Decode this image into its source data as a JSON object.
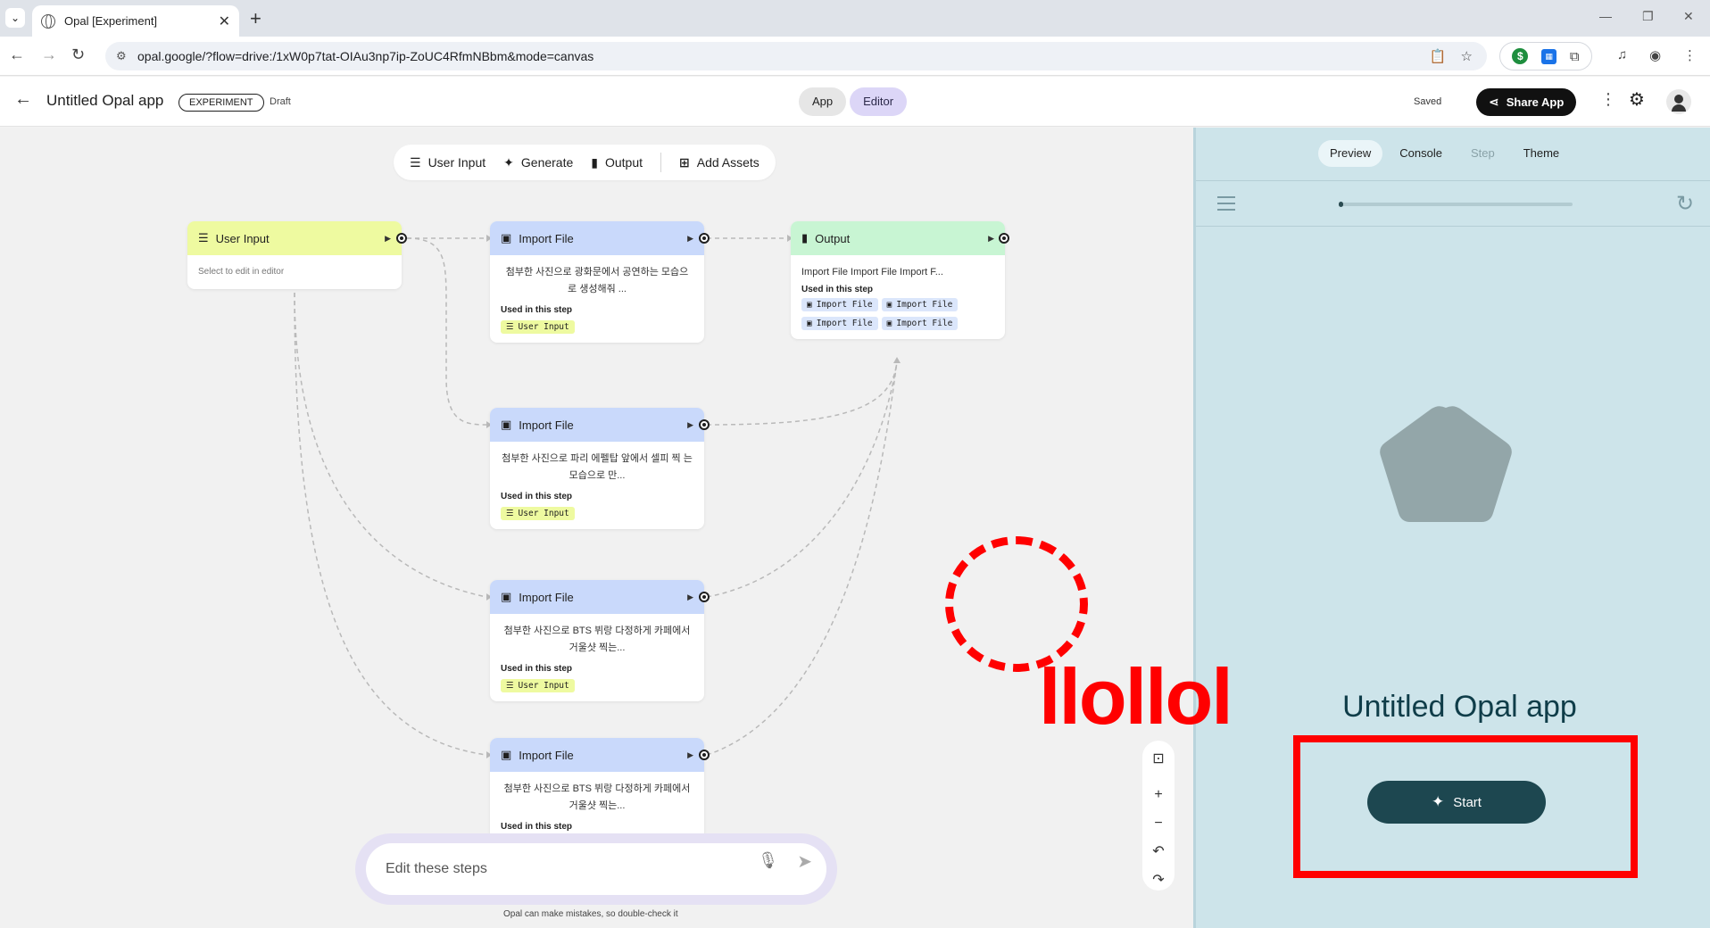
{
  "browser": {
    "tab_title": "Opal [Experiment]",
    "url": "opal.google/?flow=drive:/1xW0p7tat-OIAu3np7ip-ZoUC4RfmNBbm&mode=canvas"
  },
  "header": {
    "title": "Untitled Opal app",
    "badge": "EXPERIMENT",
    "status": "Draft",
    "modes": [
      "App",
      "Editor"
    ],
    "active_mode": "Editor",
    "saved": "Saved",
    "share": "Share App"
  },
  "stepbar": {
    "user_input": "User Input",
    "generate": "Generate",
    "output": "Output",
    "add_assets": "Add Assets"
  },
  "nodes": {
    "user_input": {
      "title": "User Input",
      "hint": "Select to edit in editor"
    },
    "import1": {
      "title": "Import File",
      "prompt": "첨부한 사진으로 광화문에서 공연하는 모습으 로 생성해줘 ...",
      "used_label": "Used in this step",
      "chip": "User Input"
    },
    "import2": {
      "title": "Import File",
      "prompt": "첨부한 사진으로 파리 에펠탑 앞에서 셀피 찍 는 모습으로 만...",
      "used_label": "Used in this step",
      "chip": "User Input"
    },
    "import3": {
      "title": "Import File",
      "prompt": "첨부한 사진으로 BTS 뷔랑 다정하게 카페에서 거울샷 찍는...",
      "used_label": "Used in this step",
      "chip": "User Input"
    },
    "import4": {
      "title": "Import File",
      "prompt": "첨부한 사진으로 BTS 뷔랑 다정하게 카페에서 거울샷 찍는...",
      "used_label": "Used in this step"
    },
    "output": {
      "title": "Output",
      "prompt": "Import File Import File Import F...",
      "used_label": "Used in this step",
      "chips": [
        "Import File",
        "Import File",
        "Import File",
        "Import File"
      ]
    }
  },
  "chat": {
    "placeholder": "Edit these steps",
    "disclaimer": "Opal can make mistakes, so double-check it"
  },
  "annotation": {
    "text": "llollol"
  },
  "preview": {
    "tabs": [
      "Preview",
      "Console",
      "Step",
      "Theme"
    ],
    "active_tab": "Preview",
    "app_title": "Untitled Opal app",
    "start": "Start",
    "progress_fraction": 0.02
  },
  "colors": {
    "input_header": "#eefaa0",
    "import_header": "#c9d9fb",
    "output_header": "#c8f5d3",
    "preview_bg": "#cde4ea",
    "start_button": "#1d4750",
    "annotation": "#ff0000"
  }
}
